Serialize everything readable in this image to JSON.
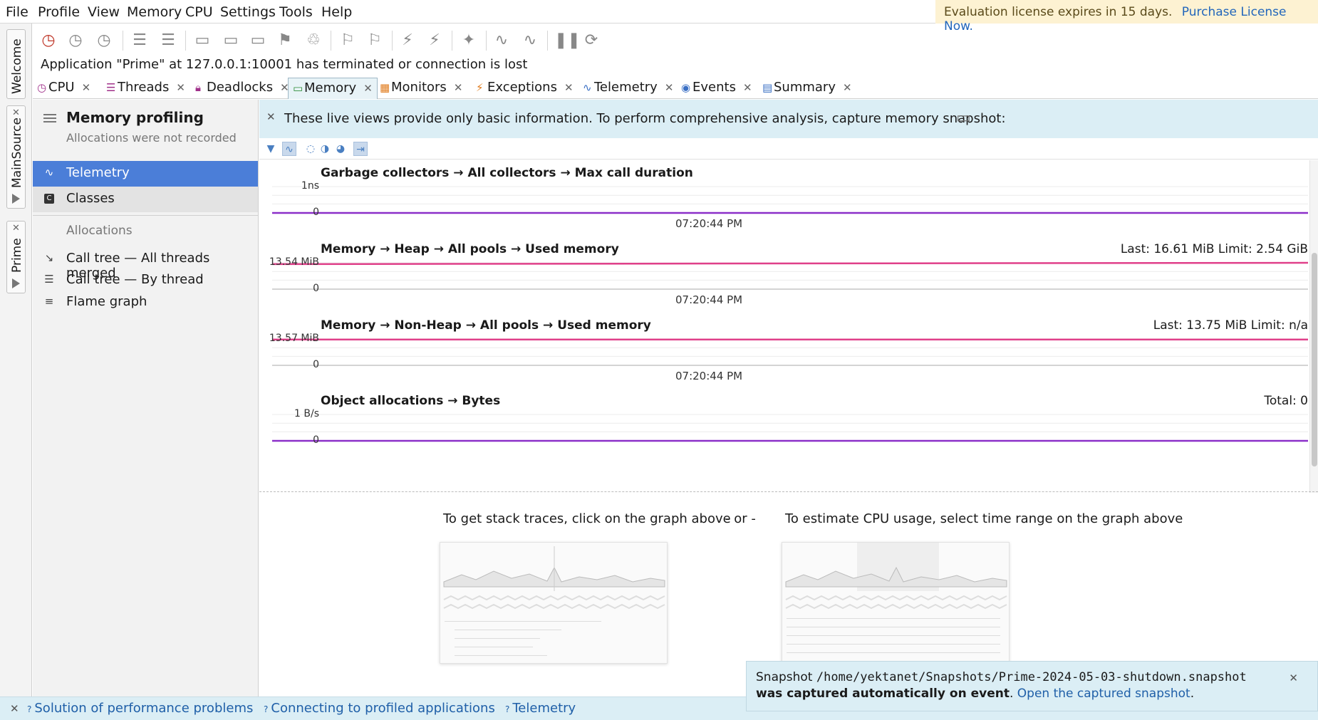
{
  "menubar": {
    "items": [
      "File",
      "Profile",
      "View",
      "Memory",
      "CPU",
      "Settings",
      "Tools",
      "Help"
    ],
    "license_text": "Evaluation license expires in 15 days.",
    "license_link": "Purchase License Now."
  },
  "left_strip": {
    "tabs": [
      "Welcome",
      "MainSource",
      "Prime"
    ]
  },
  "status_message": "Application \"Prime\" at 127.0.0.1:10001 has terminated or connection is lost",
  "tabs": [
    {
      "label": "CPU",
      "icon": "clock-icon",
      "color": "#a0308a"
    },
    {
      "label": "Threads",
      "icon": "threads-icon",
      "color": "#a0308a"
    },
    {
      "label": "Deadlocks",
      "icon": "lock-icon",
      "color": "#a0308a"
    },
    {
      "label": "Memory",
      "icon": "memory-chip-icon",
      "color": "#2f8f3a",
      "active": true
    },
    {
      "label": "Monitors",
      "icon": "monitor-icon",
      "color": "#e07a1a"
    },
    {
      "label": "Exceptions",
      "icon": "lightning-icon",
      "color": "#e07a1a"
    },
    {
      "label": "Telemetry",
      "icon": "pulse-icon",
      "color": "#3a6fc4"
    },
    {
      "label": "Events",
      "icon": "eye-icon",
      "color": "#3a6fc4"
    },
    {
      "label": "Summary",
      "icon": "clipboard-icon",
      "color": "#3a6fc4"
    }
  ],
  "side_panel": {
    "title": "Memory profiling",
    "subtitle": "Allocations were not recorded",
    "items": [
      {
        "label": "Telemetry",
        "icon": "pulse-icon",
        "selected": true
      },
      {
        "label": "Classes",
        "icon": "class-icon"
      }
    ],
    "allocations_header": "Allocations",
    "allocation_items": [
      {
        "label": "Call tree — All threads merged",
        "icon": "call-tree-arrow-icon"
      },
      {
        "label": "Call tree — By thread",
        "icon": "call-tree-thread-icon"
      },
      {
        "label": "Flame graph",
        "icon": "flame-graph-icon"
      }
    ]
  },
  "banner": {
    "text": "These live views provide only basic information. To perform comprehensive analysis, capture memory snapshot:"
  },
  "graphs": [
    {
      "title": "Garbage collectors → All collectors → Max call duration",
      "right": "",
      "y_top": "1ns",
      "y_zero": "0",
      "time": "07:20:44 PM",
      "color": "#8b2fc9",
      "value_fraction": 0.0
    },
    {
      "title": "Memory → Heap → All pools → Used memory",
      "right": "Last: 16.61 MiB   Limit: 2.54 GiB",
      "y_top": "13.54 MiB",
      "y_zero": "0",
      "time": "07:20:44 PM",
      "color": "#e0408a",
      "value_fraction_start": 0.95,
      "value_fraction_end": 1.0
    },
    {
      "title": "Memory → Non-Heap → All pools → Used memory",
      "right": "Last: 13.75 MiB   Limit: n/a",
      "y_top": "13.57 MiB",
      "y_zero": "0",
      "time": "07:20:44 PM",
      "color": "#e0408a",
      "value_fraction_start": 0.98,
      "value_fraction_end": 0.98
    },
    {
      "title": "Object allocations → Bytes",
      "right": "Total: 0",
      "y_top": "1 B/s",
      "y_zero": "0",
      "time": "",
      "color": "#8b2fc9",
      "value_fraction": 0.0
    }
  ],
  "hints": {
    "left": "To get stack traces, click on the graph above",
    "or": "- or -",
    "right": "To estimate CPU usage, select time range on the graph above"
  },
  "bottom_links": [
    "Solution of performance problems",
    "Connecting to profiled applications",
    "Telemetry"
  ],
  "notification": {
    "prefix": "Snapshot",
    "path": "/home/yektanet/Snapshots/Prime-2024-05-03-shutdown.snapshot",
    "bold": "was captured automatically on event",
    "link": "Open the captured snapshot",
    "suffix": "."
  }
}
